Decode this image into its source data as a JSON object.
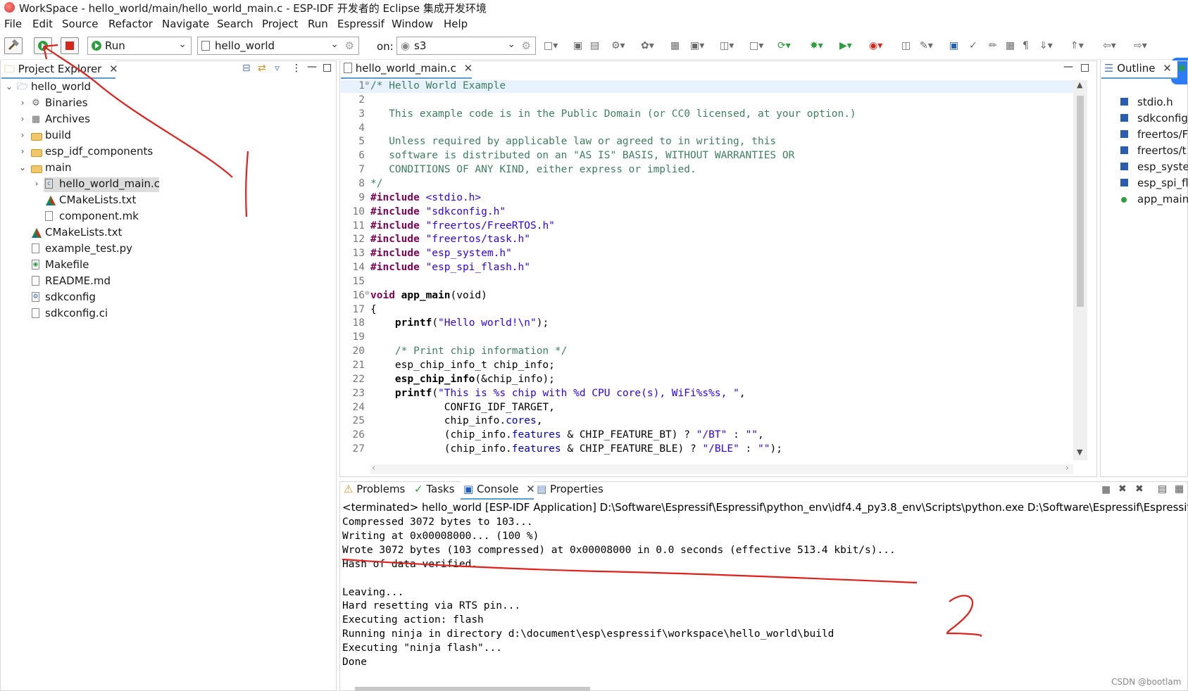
{
  "window": {
    "title": "WorkSpace - hello_world/main/hello_world_main.c - ESP-IDF 开发者的 Eclipse 集成开发环境"
  },
  "menu": [
    "File",
    "Edit",
    "Source",
    "Refactor",
    "Navigate",
    "Search",
    "Project",
    "Run",
    "Espressif",
    "Window",
    "Help"
  ],
  "toolbar": {
    "launch_mode": "Run",
    "launch_config": "hello_world",
    "on_label": "on:",
    "target": "s3"
  },
  "project_explorer": {
    "tab_label": "Project Explorer",
    "items": [
      {
        "label": "hello_world",
        "depth": 0,
        "expanded": true,
        "icon": "project-icon"
      },
      {
        "label": "Binaries",
        "depth": 1,
        "expanded": false,
        "icon": "binaries-icon"
      },
      {
        "label": "Archives",
        "depth": 1,
        "expanded": false,
        "icon": "archives-icon"
      },
      {
        "label": "build",
        "depth": 1,
        "expanded": false,
        "icon": "folder-icon"
      },
      {
        "label": "esp_idf_components",
        "depth": 1,
        "expanded": false,
        "icon": "folder-icon"
      },
      {
        "label": "main",
        "depth": 1,
        "expanded": true,
        "icon": "folder-icon"
      },
      {
        "label": "hello_world_main.c",
        "depth": 2,
        "expanded": false,
        "icon": "c-file-icon",
        "selected": true
      },
      {
        "label": "CMakeLists.txt",
        "depth": 2,
        "icon": "cmake-icon"
      },
      {
        "label": "component.mk",
        "depth": 2,
        "icon": "file-icon"
      },
      {
        "label": "CMakeLists.txt",
        "depth": 1,
        "icon": "cmake-icon"
      },
      {
        "label": "example_test.py",
        "depth": 1,
        "icon": "file-icon"
      },
      {
        "label": "Makefile",
        "depth": 1,
        "icon": "makefile-icon"
      },
      {
        "label": "README.md",
        "depth": 1,
        "icon": "file-icon"
      },
      {
        "label": "sdkconfig",
        "depth": 1,
        "icon": "config-icon"
      },
      {
        "label": "sdkconfig.ci",
        "depth": 1,
        "icon": "file-icon"
      }
    ]
  },
  "editor": {
    "tab_label": "hello_world_main.c",
    "lines": [
      [
        {
          "t": "/* Hello World Example",
          "c": "cmt"
        }
      ],
      [],
      [
        {
          "t": "   This example code is in the Public Domain (or CC0 licensed, at your option.)",
          "c": "cmt"
        }
      ],
      [],
      [
        {
          "t": "   Unless required by applicable law or agreed to in writing, this",
          "c": "cmt"
        }
      ],
      [
        {
          "t": "   software is distributed on an \"AS IS\" BASIS, WITHOUT WARRANTIES OR",
          "c": "cmt"
        }
      ],
      [
        {
          "t": "   CONDITIONS OF ANY KIND, either express or implied.",
          "c": "cmt"
        }
      ],
      [
        {
          "t": "*/",
          "c": "cmt"
        }
      ],
      [
        {
          "t": "#include",
          "c": "kw"
        },
        {
          "t": " ",
          "c": "plain"
        },
        {
          "t": "<stdio.h>",
          "c": "str"
        }
      ],
      [
        {
          "t": "#include",
          "c": "kw"
        },
        {
          "t": " ",
          "c": "plain"
        },
        {
          "t": "\"sdkconfig.h\"",
          "c": "str"
        }
      ],
      [
        {
          "t": "#include",
          "c": "kw"
        },
        {
          "t": " ",
          "c": "plain"
        },
        {
          "t": "\"freertos/FreeRTOS.h\"",
          "c": "str"
        }
      ],
      [
        {
          "t": "#include",
          "c": "kw"
        },
        {
          "t": " ",
          "c": "plain"
        },
        {
          "t": "\"freertos/task.h\"",
          "c": "str"
        }
      ],
      [
        {
          "t": "#include",
          "c": "kw"
        },
        {
          "t": " ",
          "c": "plain"
        },
        {
          "t": "\"esp_system.h\"",
          "c": "str"
        }
      ],
      [
        {
          "t": "#include",
          "c": "kw"
        },
        {
          "t": " ",
          "c": "plain"
        },
        {
          "t": "\"esp_spi_flash.h\"",
          "c": "str"
        }
      ],
      [],
      [
        {
          "t": "void",
          "c": "kw"
        },
        {
          "t": " ",
          "c": "plain"
        },
        {
          "t": "app_main",
          "c": "fn"
        },
        {
          "t": "(void)",
          "c": "plain"
        }
      ],
      [
        {
          "t": "{",
          "c": "plain"
        }
      ],
      [
        {
          "t": "    ",
          "c": "plain"
        },
        {
          "t": "printf",
          "c": "fn"
        },
        {
          "t": "(",
          "c": "plain"
        },
        {
          "t": "\"Hello world!\\n\"",
          "c": "str"
        },
        {
          "t": ");",
          "c": "plain"
        }
      ],
      [],
      [
        {
          "t": "    /* Print chip information */",
          "c": "cmt"
        }
      ],
      [
        {
          "t": "    esp_chip_info_t chip_info;",
          "c": "plain"
        }
      ],
      [
        {
          "t": "    ",
          "c": "plain"
        },
        {
          "t": "esp_chip_info",
          "c": "fn"
        },
        {
          "t": "(&chip_info);",
          "c": "plain"
        }
      ],
      [
        {
          "t": "    ",
          "c": "plain"
        },
        {
          "t": "printf",
          "c": "fn"
        },
        {
          "t": "(",
          "c": "plain"
        },
        {
          "t": "\"This is %s chip with %d CPU core(s), WiFi%s%s, \"",
          "c": "str"
        },
        {
          "t": ",",
          "c": "plain"
        }
      ],
      [
        {
          "t": "            CONFIG_IDF_TARGET,",
          "c": "plain"
        }
      ],
      [
        {
          "t": "            chip_info.",
          "c": "plain"
        },
        {
          "t": "cores",
          "c": "fld"
        },
        {
          "t": ",",
          "c": "plain"
        }
      ],
      [
        {
          "t": "            (chip_info.",
          "c": "plain"
        },
        {
          "t": "features",
          "c": "fld"
        },
        {
          "t": " & CHIP_FEATURE_BT) ? ",
          "c": "plain"
        },
        {
          "t": "\"/BT\"",
          "c": "str"
        },
        {
          "t": " : ",
          "c": "plain"
        },
        {
          "t": "\"\"",
          "c": "str"
        },
        {
          "t": ",",
          "c": "plain"
        }
      ],
      [
        {
          "t": "            (chip_info.",
          "c": "plain"
        },
        {
          "t": "features",
          "c": "fld"
        },
        {
          "t": " & CHIP_FEATURE_BLE) ? ",
          "c": "plain"
        },
        {
          "t": "\"/BLE\"",
          "c": "str"
        },
        {
          "t": " : ",
          "c": "plain"
        },
        {
          "t": "\"\"",
          "c": "str"
        },
        {
          "t": ");",
          "c": "plain"
        }
      ]
    ]
  },
  "outline": {
    "tab_label": "Outline",
    "items": [
      {
        "label": "stdio.h",
        "icon": "include-icon"
      },
      {
        "label": "sdkconfig",
        "icon": "include-icon"
      },
      {
        "label": "freertos/F",
        "icon": "include-icon"
      },
      {
        "label": "freertos/t",
        "icon": "include-icon"
      },
      {
        "label": "esp_syster",
        "icon": "include-icon"
      },
      {
        "label": "esp_spi_fl",
        "icon": "include-icon"
      },
      {
        "label": "app_main",
        "icon": "function-icon"
      }
    ]
  },
  "bottom_tabs": [
    "Problems",
    "Tasks",
    "Console",
    "Properties"
  ],
  "console": {
    "header": "<terminated> hello_world [ESP-IDF Application] D:\\Software\\Espressif\\Espressif\\python_env\\idf4.4_py3.8_env\\Scripts\\python.exe D:\\Software\\Espressif\\Espressif\\fram",
    "lines": [
      "Compressed 3072 bytes to 103...",
      "Writing at 0x00008000... (100 %)",
      "Wrote 3072 bytes (103 compressed) at 0x00008000 in 0.0 seconds (effective 513.4 kbit/s)...",
      "Hash of data verified.",
      "",
      "Leaving...",
      "Hard resetting via RTS pin...",
      "Executing action: flash",
      "Running ninja in directory d:\\document\\esp\\espressif\\workspace\\hello_world\\build",
      "Executing \"ninja flash\"...",
      "Done"
    ]
  },
  "annotations": {
    "mark_1": "1.",
    "mark_2": "2"
  },
  "watermark": "CSDN @bootlam",
  "colors": {
    "annotation": "#e0201b",
    "accent": "#5b9bd5",
    "comment": "#3f7f5f",
    "keyword": "#7f0055",
    "string": "#2a00ff"
  }
}
